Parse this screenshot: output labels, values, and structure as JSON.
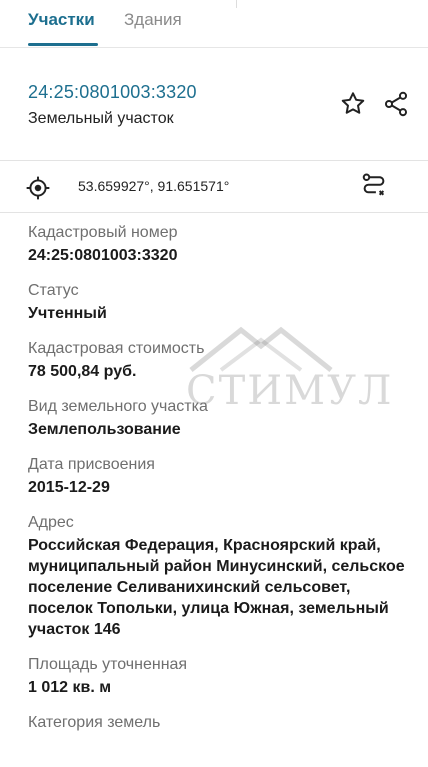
{
  "tabs": {
    "active_label": "Участки",
    "inactive_label": "Здания"
  },
  "header": {
    "cadastral_link": "24:25:0801003:3320",
    "object_type": "Земельный участок",
    "star_icon": "star-outline-icon",
    "share_icon": "share-icon"
  },
  "location": {
    "coordinates": "53.659927°, 91.651571°",
    "locate_icon": "crosshair-icon",
    "route_icon": "route-icon"
  },
  "fields": [
    {
      "label": "Кадастровый номер",
      "value": "24:25:0801003:3320"
    },
    {
      "label": "Статус",
      "value": "Учтенный"
    },
    {
      "label": "Кадастровая стоимость",
      "value": "78 500,84 руб."
    },
    {
      "label": "Вид земельного участка",
      "value": "Землепользование"
    },
    {
      "label": "Дата присвоения",
      "value": "2015-12-29"
    },
    {
      "label": "Адрес",
      "value": "Российская Федерация, Красноярский край, муниципальный район Минусинский, сельское поселение Селиванихинский сельсовет, поселок Топольки, улица Южная, земельный участок 146"
    },
    {
      "label": "Площадь уточненная",
      "value": "1 012 кв. м"
    },
    {
      "label": "Категория земель",
      "value": ""
    }
  ],
  "watermark": {
    "text": "СТИМУЛ"
  },
  "colors": {
    "accent": "#1d6f8f",
    "label": "#6f6f6f",
    "value": "#1b1b1b"
  }
}
